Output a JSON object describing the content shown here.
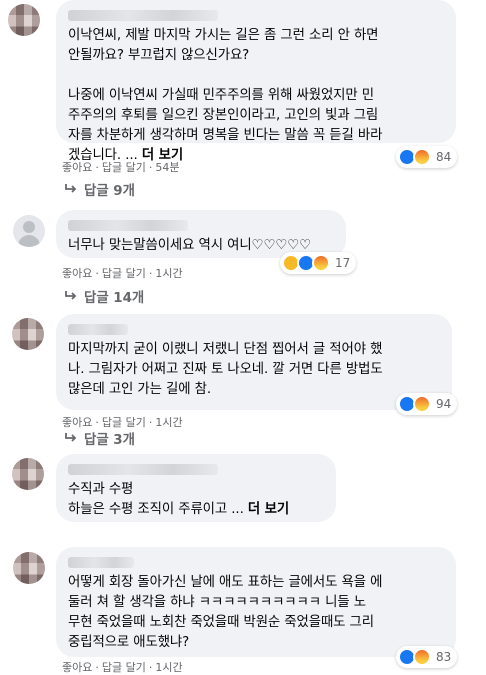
{
  "comments": [
    {
      "text": "이낙연씨, 제발 마지막 가시는 길은 좀 그런 소리 안 하면\n안될까요? 부끄럽지 않으신가요?\n\n나중에 이낙연씨 가실때 민주주의를 위해 싸웠었지만 민\n주주의의 후퇴를 일으킨 장본인이라고, 고인의 빛과 그림\n자를 차분하게 생각하며 명복을 빈다는 말씀 꼭 듣길 바라\n겠습니다. ...",
      "more": "더 보기",
      "like": "좋아요",
      "reply": "답글 달기",
      "time": "54분",
      "reaction_count": "84",
      "replies": "답글 9개"
    },
    {
      "text": "너무나 맞는말씀이세요 역시 여니♡♡♡♡♡",
      "like": "좋아요",
      "reply": "답글 달기",
      "time": "1시간",
      "reaction_count": "17",
      "replies": "답글 14개"
    },
    {
      "text": "마지막까지 굳이 이랬니 저랬니 단점 찝어서 글 적어야 했\n나. 그림자가 어쩌고 진짜 토 나오네. 깔 거면 다른 방법도\n많은데 고인 가는 길에 참.",
      "like": "좋아요",
      "reply": "답글 달기",
      "time": "1시간",
      "reaction_count": "94",
      "replies": "답글 3개"
    },
    {
      "text": "수직과 수평\n하늘은 수평 조직이 주류이고 ...",
      "more": "더 보기"
    },
    {
      "text": "어떻게 회장 돌아가신 날에 애도 표하는 글에서도 욕을 에\n둘러 쳐 할 생각을 하냐 ㅋㅋㅋㅋㅋㅋㅋㅋㅋㅋ 니들 노\n무현 죽었을때 노회찬 죽었을때 박원순 죽었을때도 그리\n중립적으로 애도했냐?",
      "like": "좋아요",
      "reply": "답글 달기",
      "time": "1시간",
      "reaction_count": "83"
    }
  ],
  "colors": {
    "bubble": "#f0f2f5",
    "meta": "#65676b",
    "like": "#1877f2"
  },
  "icons": [
    "like-icon",
    "angry-icon",
    "haha-icon",
    "reply-arrow-icon"
  ]
}
